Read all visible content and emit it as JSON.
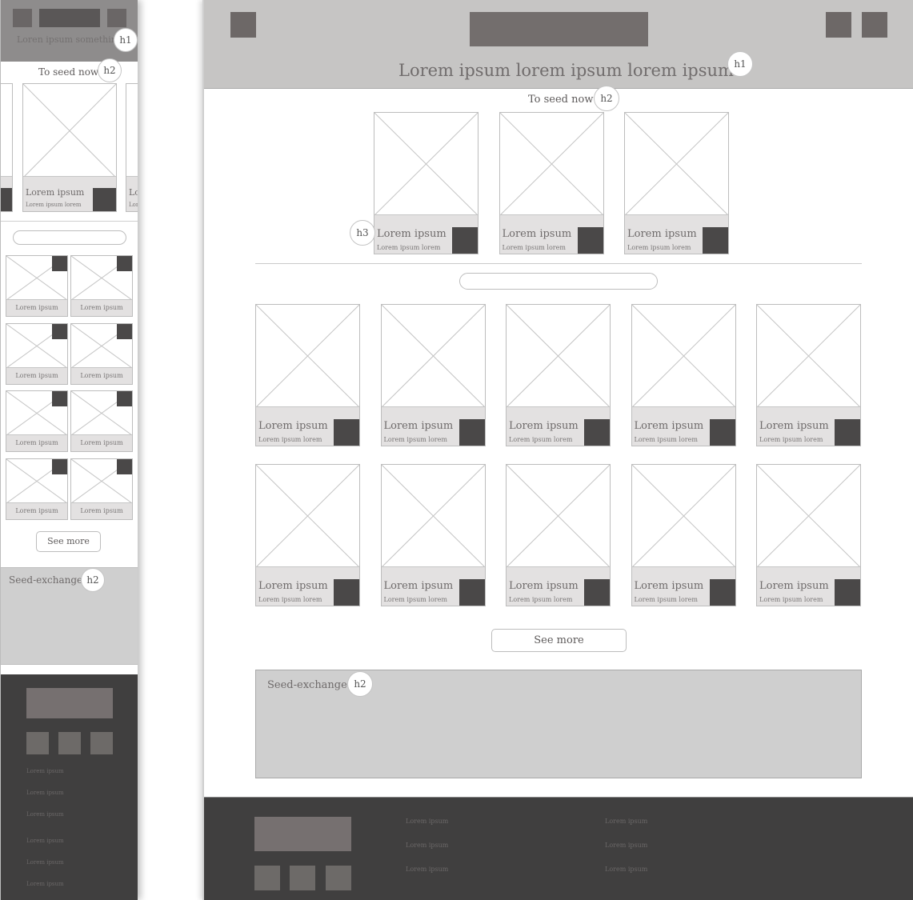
{
  "mobile": {
    "header": {
      "title": "Loren ipsum something",
      "title_badge": "h1"
    },
    "seed_now": {
      "title": "To seed now",
      "badge": "h2",
      "card": {
        "title": "Lorem ipsum",
        "subtitle": "Lorem ipsum lorem"
      },
      "peek_right": {
        "title": "Lo",
        "subtitle": "Lor"
      }
    },
    "search": {
      "placeholder": ""
    },
    "grid_items": [
      {
        "label": "Lorem ipsum"
      },
      {
        "label": "Lorem ipsum"
      },
      {
        "label": "Lorem ipsum"
      },
      {
        "label": "Lorem ipsum"
      },
      {
        "label": "Lorem ipsum"
      },
      {
        "label": "Lorem ipsum"
      },
      {
        "label": "Lorem ipsum"
      },
      {
        "label": "Lorem ipsum"
      }
    ],
    "see_more": "See more",
    "exchange": {
      "title": "Seed-exchange",
      "badge": "h2"
    },
    "footer": {
      "links": [
        "Lorem ipsum",
        "Lorem ipsum",
        "Lorem ipsum",
        "Lorem ipsum",
        "Lorem ipsum",
        "Lorem ipsum"
      ]
    }
  },
  "desktop": {
    "header": {
      "title": "Lorem ipsum lorem ipsum lorem ipsum",
      "title_badge": "h1"
    },
    "seed_now": {
      "title": "To seed now",
      "badge": "h2",
      "card_badge": "h3",
      "cards": [
        {
          "title": "Lorem ipsum",
          "subtitle": "Lorem ipsum lorem"
        },
        {
          "title": "Lorem ipsum",
          "subtitle": "Lorem ipsum lorem"
        },
        {
          "title": "Lorem ipsum",
          "subtitle": "Lorem ipsum lorem"
        }
      ]
    },
    "search": {
      "placeholder": ""
    },
    "grid_items": [
      {
        "title": "Lorem ipsum",
        "subtitle": "Lorem ipsum lorem"
      },
      {
        "title": "Lorem ipsum",
        "subtitle": "Lorem ipsum lorem"
      },
      {
        "title": "Lorem ipsum",
        "subtitle": "Lorem ipsum lorem"
      },
      {
        "title": "Lorem ipsum",
        "subtitle": "Lorem ipsum lorem"
      },
      {
        "title": "Lorem ipsum",
        "subtitle": "Lorem ipsum lorem"
      },
      {
        "title": "Lorem ipsum",
        "subtitle": "Lorem ipsum lorem"
      },
      {
        "title": "Lorem ipsum",
        "subtitle": "Lorem ipsum lorem"
      },
      {
        "title": "Lorem ipsum",
        "subtitle": "Lorem ipsum lorem"
      },
      {
        "title": "Lorem ipsum",
        "subtitle": "Lorem ipsum lorem"
      },
      {
        "title": "Lorem ipsum",
        "subtitle": "Lorem ipsum lorem"
      }
    ],
    "see_more": "See more",
    "exchange": {
      "title": "Seed-exchange",
      "badge": "h2"
    },
    "footer": {
      "links_col1": [
        "Lorem ipsum",
        "Lorem ipsum",
        "Lorem ipsum"
      ],
      "links_col2": [
        "Lorem ipsum",
        "Lorem ipsum",
        "Lorem ipsum"
      ]
    }
  },
  "colors": {
    "header_mobile": "#8e8c8c",
    "header_desktop": "#c6c5c4",
    "placeholder_box": "#6d6867",
    "card_info": "#e3e1e1",
    "cart_square": "#4a4848",
    "exchange_bg": "#cfcfcf",
    "footer_bg": "#403f3f"
  }
}
